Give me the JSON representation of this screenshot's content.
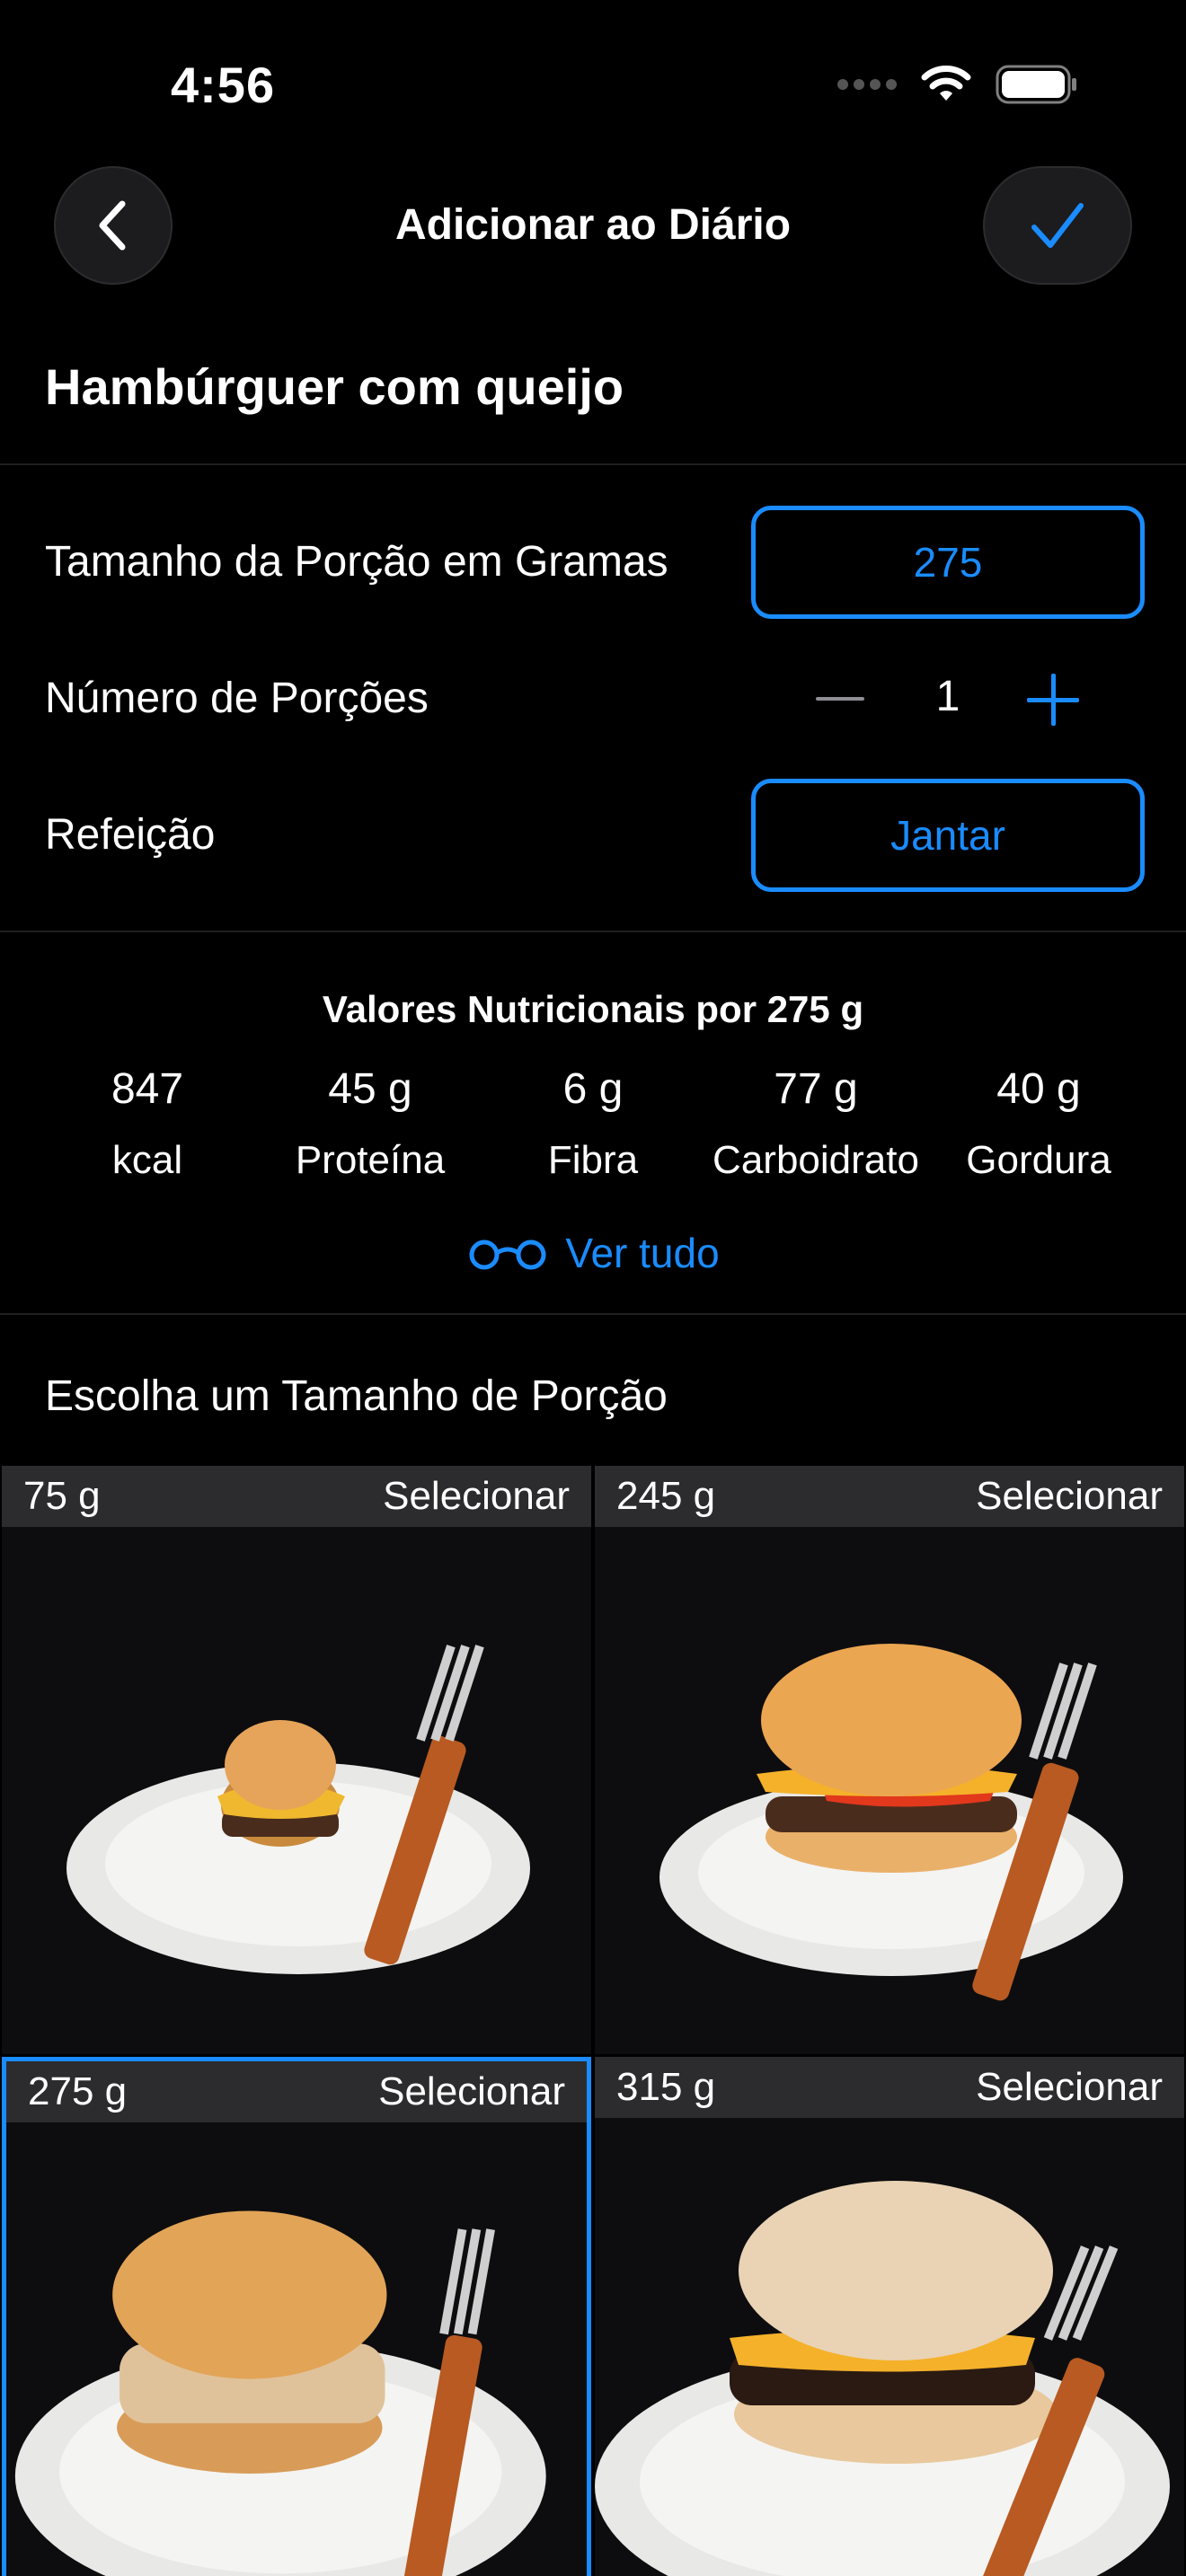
{
  "status": {
    "time": "4:56"
  },
  "nav": {
    "title": "Adicionar ao Diário"
  },
  "food": {
    "name": "Hambúrguer com queijo"
  },
  "form": {
    "portion_label": "Tamanho da Porção em Gramas",
    "portion_value": "275",
    "servings_label": "Número de Porções",
    "servings_value": "1",
    "meal_label": "Refeição",
    "meal_value": "Jantar"
  },
  "nutrition": {
    "title": "Valores Nutricionais por 275 g",
    "items": [
      {
        "value": "847",
        "label": "kcal"
      },
      {
        "value": "45 g",
        "label": "Proteína"
      },
      {
        "value": "6 g",
        "label": "Fibra"
      },
      {
        "value": "77 g",
        "label": "Carboidrato"
      },
      {
        "value": "40 g",
        "label": "Gordura"
      }
    ],
    "see_all": "Ver tudo"
  },
  "portions": {
    "title": "Escolha um Tamanho de Porção",
    "select_label": "Selecionar",
    "options": [
      {
        "grams": "75 g"
      },
      {
        "grams": "245 g"
      },
      {
        "grams": "275 g"
      },
      {
        "grams": "315 g"
      }
    ]
  },
  "colors": {
    "accent": "#1a8cff",
    "background": "#000000",
    "tile_header": "#2c2c2e"
  }
}
